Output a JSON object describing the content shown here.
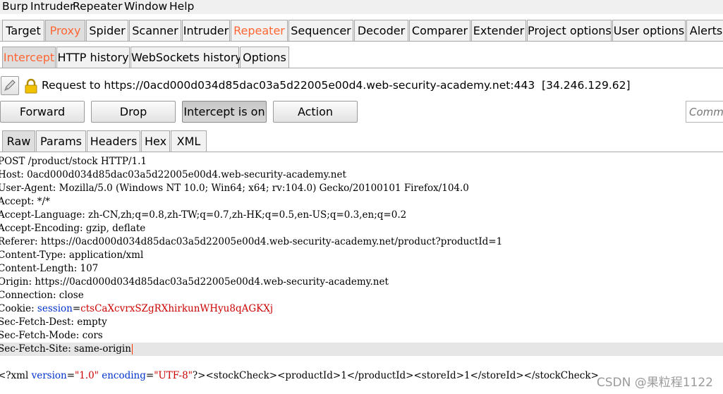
{
  "menu": [
    "Burp",
    "Intruder",
    "Repeater",
    "Window",
    "Help"
  ],
  "main_tabs": [
    "Target",
    "Proxy",
    "Spider",
    "Scanner",
    "Intruder",
    "Repeater",
    "Sequencer",
    "Decoder",
    "Comparer",
    "Extender",
    "Project options",
    "User options",
    "Alerts"
  ],
  "proxy_tabs": [
    "Intercept",
    "HTTP history",
    "WebSockets history",
    "Options"
  ],
  "request": {
    "label": "Request to https://0acd000d034d85dac03a5d22005e00d4.web-security-academy.net:443  [34.246.129.62]"
  },
  "buttons": {
    "forward": "Forward",
    "drop": "Drop",
    "intercept": "Intercept is on",
    "action": "Action"
  },
  "comment_placeholder": "Comment",
  "view_tabs": [
    "Raw",
    "Params",
    "Headers",
    "Hex",
    "XML"
  ],
  "raw_lines": [
    "POST /product/stock HTTP/1.1",
    "Host: 0acd000d034d85dac03a5d22005e00d4.web-security-academy.net",
    "User-Agent: Mozilla/5.0 (Windows NT 10.0; Win64; x64; rv:104.0) Gecko/20100101 Firefox/104.0",
    "Accept: */*",
    "Accept-Language: zh-CN,zh;q=0.8,zh-TW;q=0.7,zh-HK;q=0.5,en-US;q=0.3,en;q=0.2",
    "Accept-Encoding: gzip, deflate",
    "Referer: https://0acd000d034d85dac03a5d22005e00d4.web-security-academy.net/product?productId=1",
    "Content-Type: application/xml",
    "Content-Length: 107",
    "Origin: https://0acd000d034d85dac03a5d22005e00d4.web-security-academy.net",
    "Connection: close"
  ],
  "cookie": {
    "prefix": "Cookie: ",
    "name": "session",
    "eq": "=",
    "value": "ctsCaXcvrxSZgRXhirkunWHyu8qAGKXj"
  },
  "raw_lines_after": [
    "Sec-Fetch-Dest: empty",
    "Sec-Fetch-Mode: cors",
    "Sec-Fetch-Site: same-origin"
  ],
  "xml_body": {
    "open": "<?xml ",
    "attr1": "version",
    "eq1": "=",
    "val1": "\"1.0\"",
    "sp": " ",
    "attr2": "encoding",
    "eq2": "=",
    "val2": "\"UTF-8\"",
    "rest": "?><stockCheck><productId>1</productId><storeId>1</storeId></stockCheck>"
  },
  "watermark": "CSDN @果粒程1122",
  "colors": {
    "accent": "#ff6633",
    "xml_attr": "#0033cc",
    "xml_value": "#cc0000",
    "highlight_line": "#e6e6e6"
  }
}
